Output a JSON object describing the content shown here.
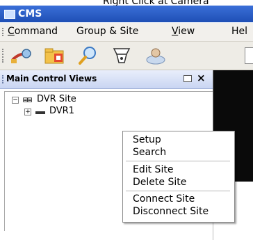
{
  "caption": "Right Click at Camera",
  "window": {
    "title": "CMS"
  },
  "menu": [
    {
      "label": "Command",
      "underline": "C",
      "rest": "ommand"
    },
    {
      "label": "Group & Site",
      "underline": "",
      "rest": "Group & Site"
    },
    {
      "label": "View",
      "underline": "V",
      "rest": "iew"
    },
    {
      "label": "Help",
      "underline": "",
      "rest": "Hel"
    }
  ],
  "toolbar": {
    "buttons": [
      "connect-icon",
      "folder-icon",
      "search-icon",
      "device-icon",
      "user-icon"
    ]
  },
  "panel": {
    "title": "Main Control Views",
    "tree": [
      {
        "label": "DVR Site",
        "expander": "−",
        "icon": "site-icon"
      },
      {
        "label": "DVR1",
        "expander": "+",
        "icon": "dvr-icon"
      }
    ]
  },
  "context_menu": {
    "groups": [
      [
        "Setup",
        "Search"
      ],
      [
        "Edit Site",
        "Delete Site"
      ],
      [
        "Connect Site",
        "Disconnect Site"
      ]
    ]
  },
  "colors": {
    "title_bar": "#2a5cc6",
    "panel_header": "#d6def5",
    "dark_view": "#0a0a0a"
  }
}
